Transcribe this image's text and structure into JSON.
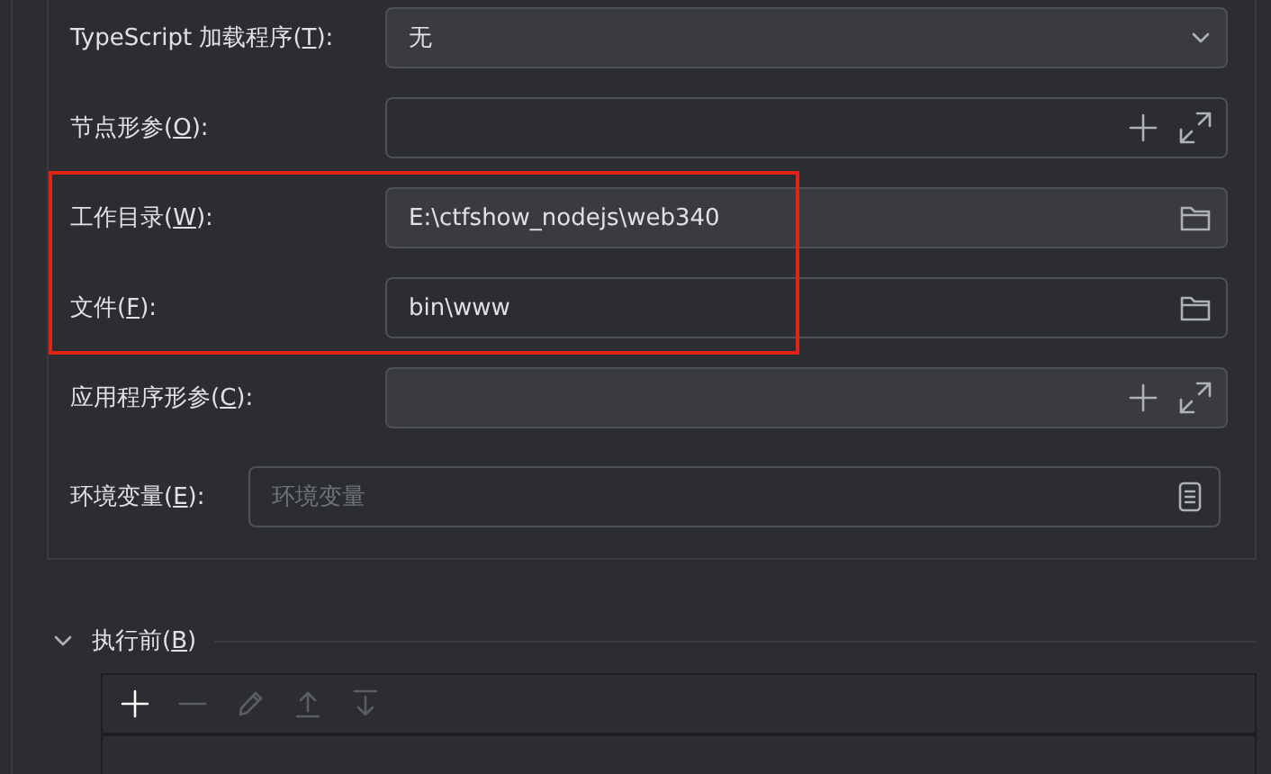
{
  "form": {
    "rows": [
      {
        "label_before": "TypeScript 加载程序(",
        "mnemonic": "T",
        "label_after": "):",
        "kind": "select",
        "value": "无",
        "highlighted": false
      },
      {
        "label_before": "节点形参(",
        "mnemonic": "O",
        "label_after": "):",
        "kind": "expandable",
        "highlighted": false
      },
      {
        "label_before": "工作目录(",
        "mnemonic": "W",
        "label_after": "):",
        "kind": "path",
        "value": "E:\\ctfshow_nodejs\\web340",
        "highlighted": true
      },
      {
        "label_before": "文件(",
        "mnemonic": "F",
        "label_after": "):",
        "kind": "path",
        "value": "bin\\www",
        "highlighted": true
      },
      {
        "label_before": "应用程序形参(",
        "mnemonic": "C",
        "label_after": "):",
        "kind": "expandable",
        "highlighted": false
      },
      {
        "label_before": "环境变量(",
        "mnemonic": "E",
        "label_after": "):",
        "kind": "env",
        "placeholder": "环境变量",
        "highlighted": false
      }
    ]
  },
  "before_launch": {
    "title_before": "执行前(",
    "mnemonic": "B",
    "title_after": ")",
    "expanded": true,
    "toolbar": [
      {
        "kind": "add",
        "disabled": false
      },
      {
        "kind": "remove",
        "disabled": true
      },
      {
        "kind": "edit",
        "disabled": true
      },
      {
        "kind": "up",
        "disabled": true
      },
      {
        "kind": "down",
        "disabled": true
      }
    ]
  }
}
